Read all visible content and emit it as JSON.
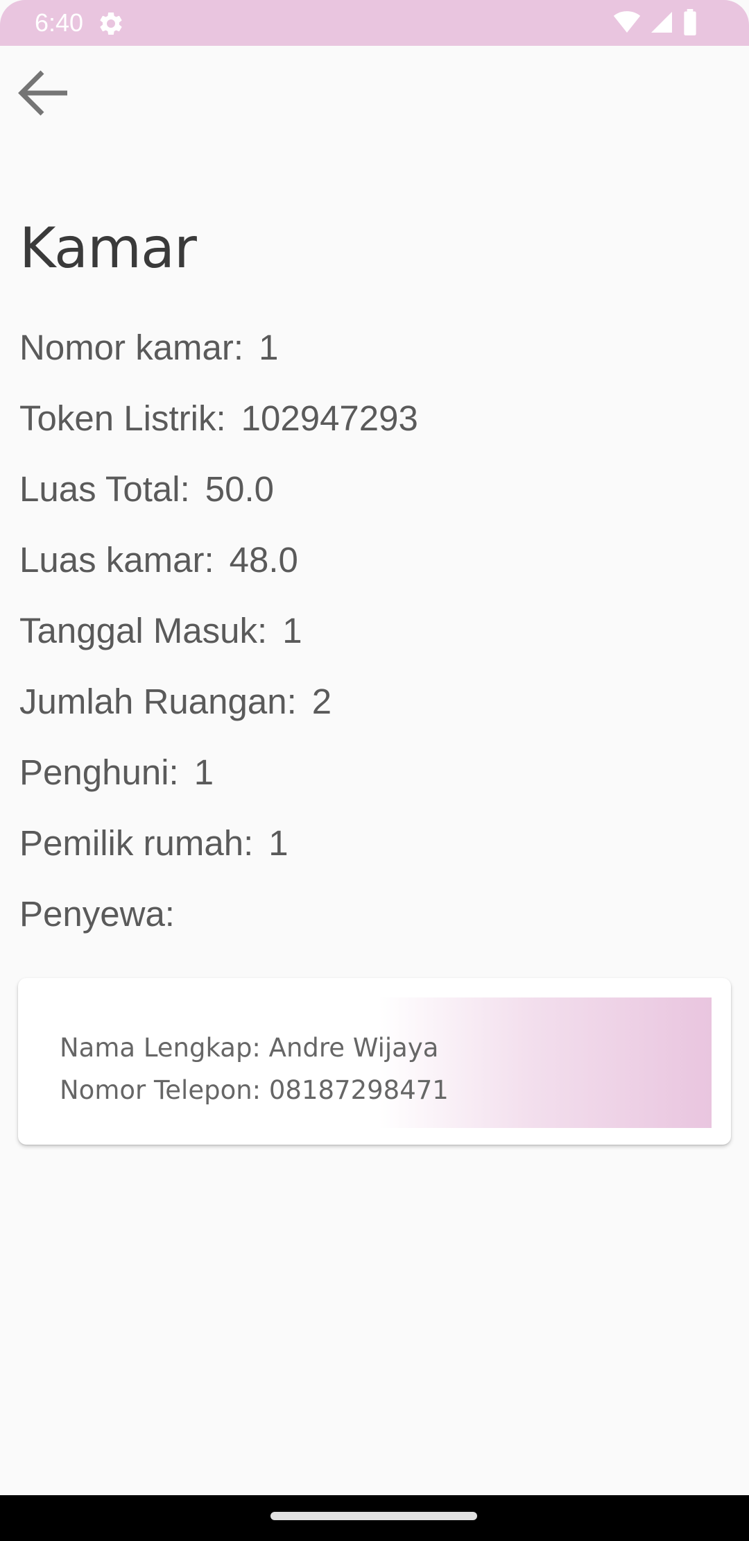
{
  "status_bar": {
    "time": "6:40",
    "settings_icon": "gear-icon",
    "wifi_icon": "wifi-icon",
    "signal_icon": "cellular-signal-icon",
    "battery_icon": "battery-icon",
    "background_color": "#e9c5df"
  },
  "toolbar": {
    "back_icon": "arrow-back-icon"
  },
  "page": {
    "title": "Kamar"
  },
  "details": [
    {
      "label": "Nomor kamar:",
      "value": "1"
    },
    {
      "label": "Token Listrik:",
      "value": "102947293"
    },
    {
      "label": "Luas Total:",
      "value": "50.0"
    },
    {
      "label": "Luas kamar:",
      "value": "48.0"
    },
    {
      "label": "Tanggal Masuk:",
      "value": "1"
    },
    {
      "label": "Jumlah Ruangan:",
      "value": "2"
    },
    {
      "label": "Penghuni:",
      "value": "1"
    },
    {
      "label": "Pemilik rumah:",
      "value": "1"
    },
    {
      "label": "Penyewa:",
      "value": ""
    }
  ],
  "tenant_card": {
    "name_line": "Nama Lengkap: Andre Wijaya",
    "phone_line": "Nomor Telepon: 08187298471",
    "accent_color": "#e9c5df"
  }
}
